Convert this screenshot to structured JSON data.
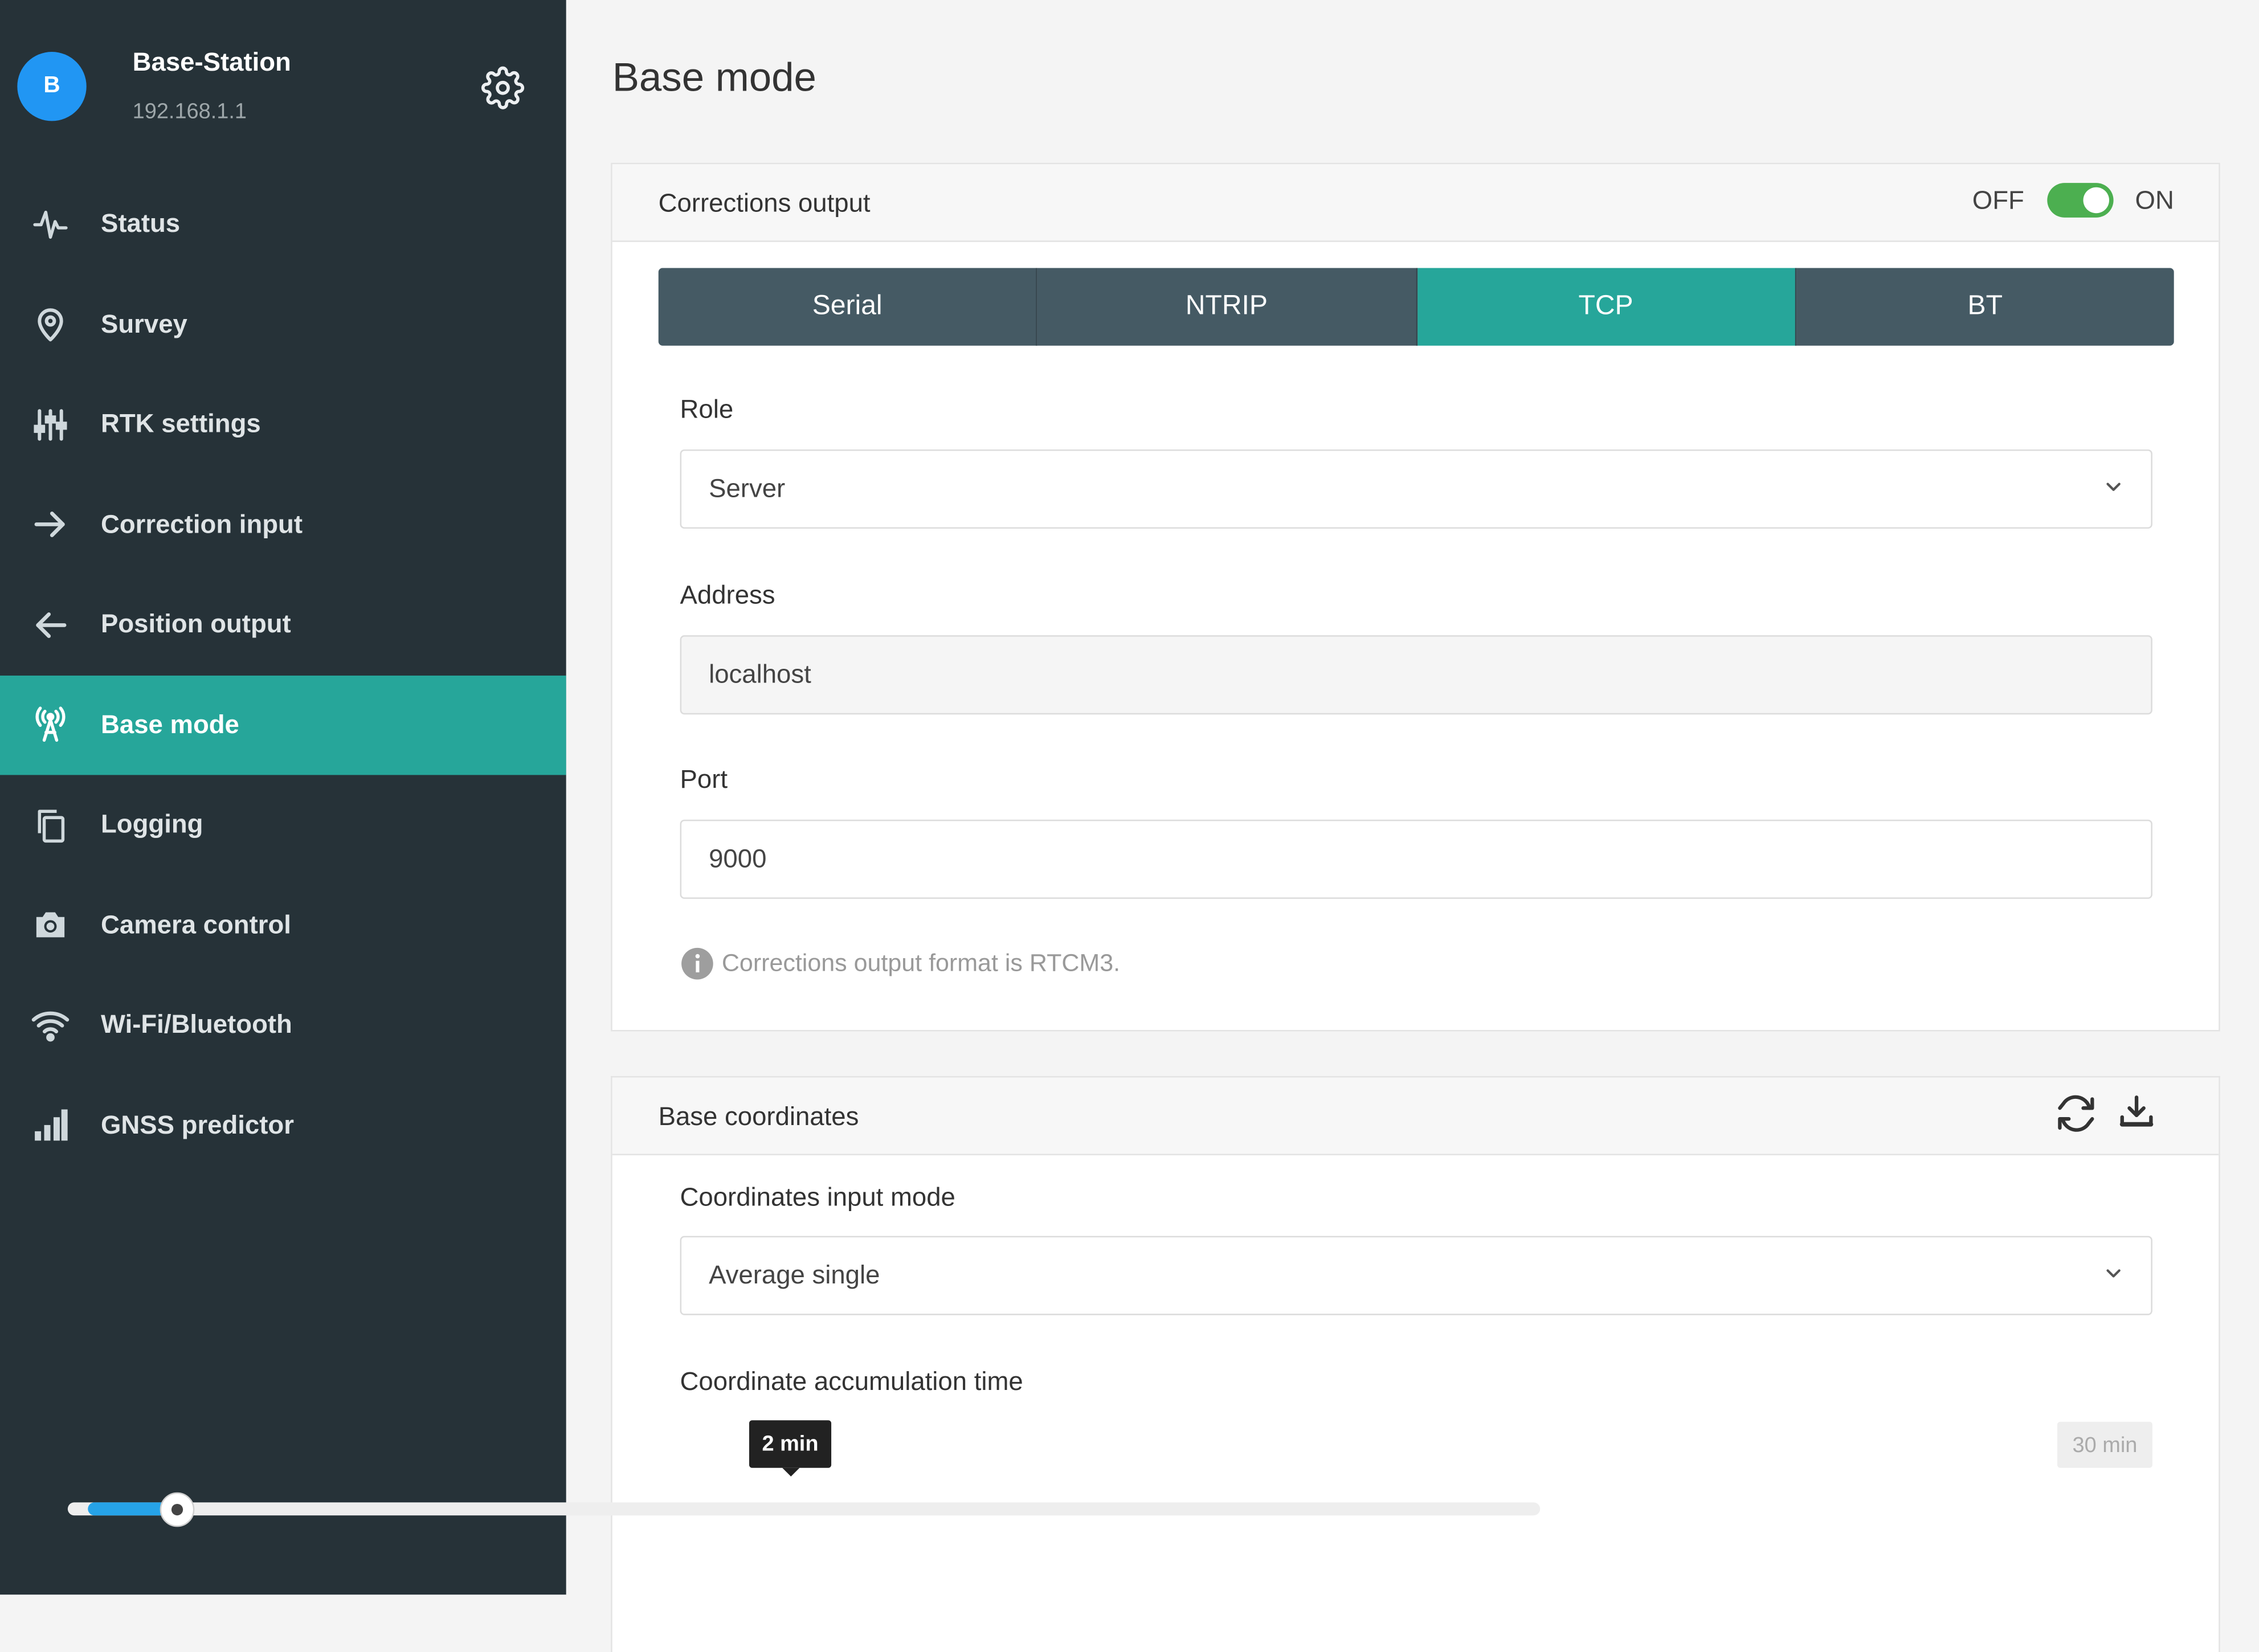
{
  "device": {
    "avatar_letter": "B",
    "name": "Base-Station",
    "ip": "192.168.1.1",
    "settings_icon": "gear-icon"
  },
  "nav": [
    {
      "label": "Status",
      "icon": "activity-icon"
    },
    {
      "label": "Survey",
      "icon": "map-pin-icon"
    },
    {
      "label": "RTK settings",
      "icon": "sliders-icon"
    },
    {
      "label": "Correction input",
      "icon": "arrow-right-icon"
    },
    {
      "label": "Position output",
      "icon": "arrow-left-icon"
    },
    {
      "label": "Base mode",
      "icon": "antenna-tower-icon",
      "active": true
    },
    {
      "label": "Logging",
      "icon": "copy-icon"
    },
    {
      "label": "Camera control",
      "icon": "camera-icon"
    },
    {
      "label": "Wi-Fi/Bluetooth",
      "icon": "wifi-icon"
    },
    {
      "label": "GNSS predictor",
      "icon": "bar-chart-icon"
    }
  ],
  "page": {
    "title": "Base mode"
  },
  "corrections": {
    "title": "Corrections output",
    "toggle_off": "OFF",
    "toggle_on": "ON",
    "toggle_state": "on",
    "tabs": [
      "Serial",
      "NTRIP",
      "TCP",
      "BT"
    ],
    "active_tab": "TCP",
    "role_label": "Role",
    "role_value": "Server",
    "address_label": "Address",
    "address_value": "localhost",
    "port_label": "Port",
    "port_value": "9000",
    "info_text": "Corrections output format is RTCM3."
  },
  "base_coords": {
    "title": "Base coordinates",
    "refresh_icon": "refresh-icon",
    "download_icon": "download-icon",
    "mode_label": "Coordinates input mode",
    "mode_value": "Average single",
    "accum_label": "Coordinate accumulation time",
    "slider_value": "2 min",
    "slider_max": "30 min",
    "slider_fraction": 0.067
  },
  "colors": {
    "sidebar_bg": "#263238",
    "accent": "#26a69a",
    "tab_bg": "#455a64",
    "toggle_on": "#4caf50",
    "slider_fill": "#26a3e8",
    "avatar": "#2196f3"
  }
}
